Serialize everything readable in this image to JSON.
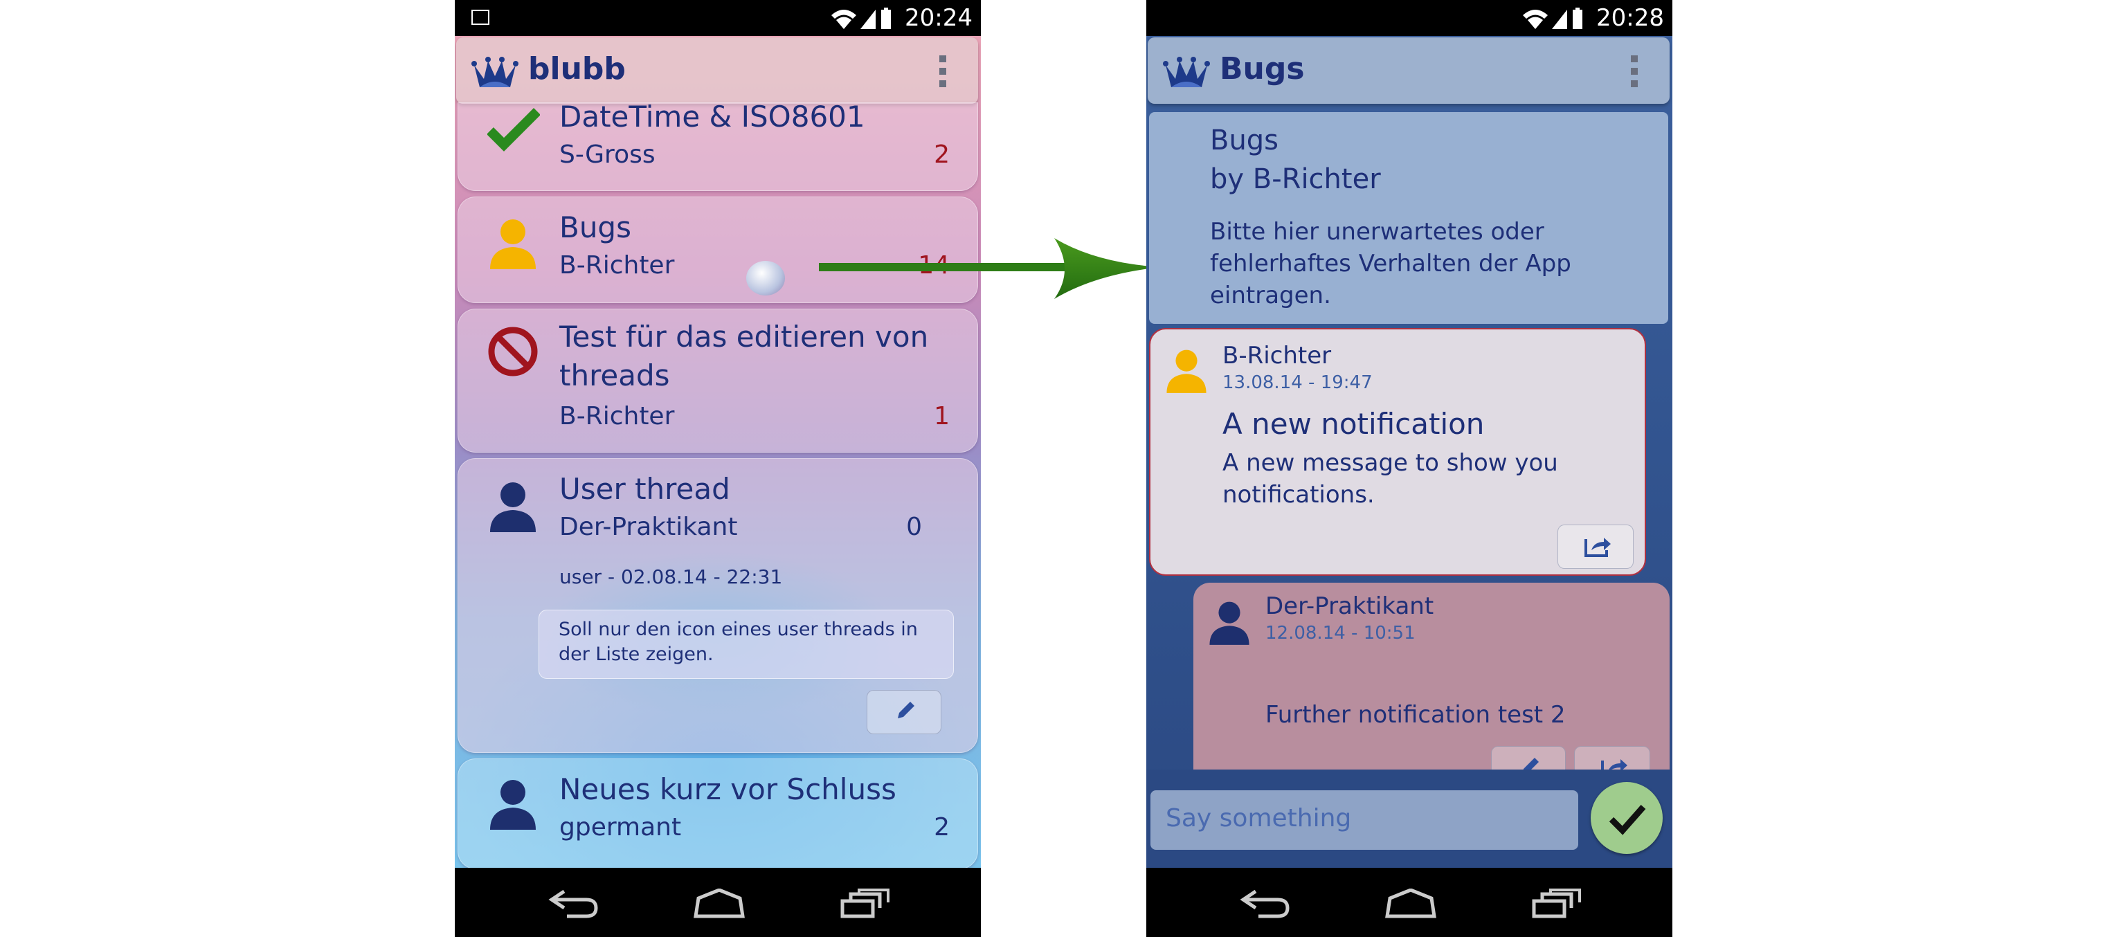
{
  "left_screen": {
    "status_time": "20:24",
    "app_title": "blubb",
    "threads": [
      {
        "title": "DateTime & ISO8601",
        "author": "S-Gross",
        "count": "2",
        "icon": "checkmark-icon"
      },
      {
        "title": "Bugs",
        "author": "B-Richter",
        "count": "14",
        "icon": "user-icon"
      },
      {
        "title": "Test für das editieren von threads",
        "author": "B-Richter",
        "count": "1",
        "icon": "no-entry-icon"
      },
      {
        "title": "User thread",
        "author": "Der-Praktikant",
        "count": "0",
        "icon": "user-icon",
        "meta": "user - 02.08.14 - 22:31",
        "message": "Soll nur den icon eines user threads in der Liste zeigen."
      },
      {
        "title": "Neues kurz vor Schluss",
        "author": "gpermant",
        "count": "2",
        "icon": "user-icon"
      }
    ]
  },
  "right_screen": {
    "status_time": "20:28",
    "app_title": "Bugs",
    "thread_title": "Bugs",
    "thread_author": "by B-Richter",
    "thread_description": "Bitte hier unerwartetes oder fehlerhaftes Verhalten der App eintragen.",
    "messages": [
      {
        "author": "B-Richter",
        "date": "13.08.14 - 19:47",
        "title": "A new notification",
        "body": "A new message to show you notifications."
      },
      {
        "author": "Der-Praktikant",
        "date": "12.08.14 - 10:51",
        "title": "",
        "body": "Further notification test 2"
      }
    ],
    "input_placeholder": "Say something"
  },
  "colors": {
    "title_text": "#1e2f78",
    "count_red": "#a0141e",
    "arrow": "#2e7d17",
    "user_icon_yellow": "#f5b400",
    "user_icon_navy": "#1e2f6e"
  }
}
